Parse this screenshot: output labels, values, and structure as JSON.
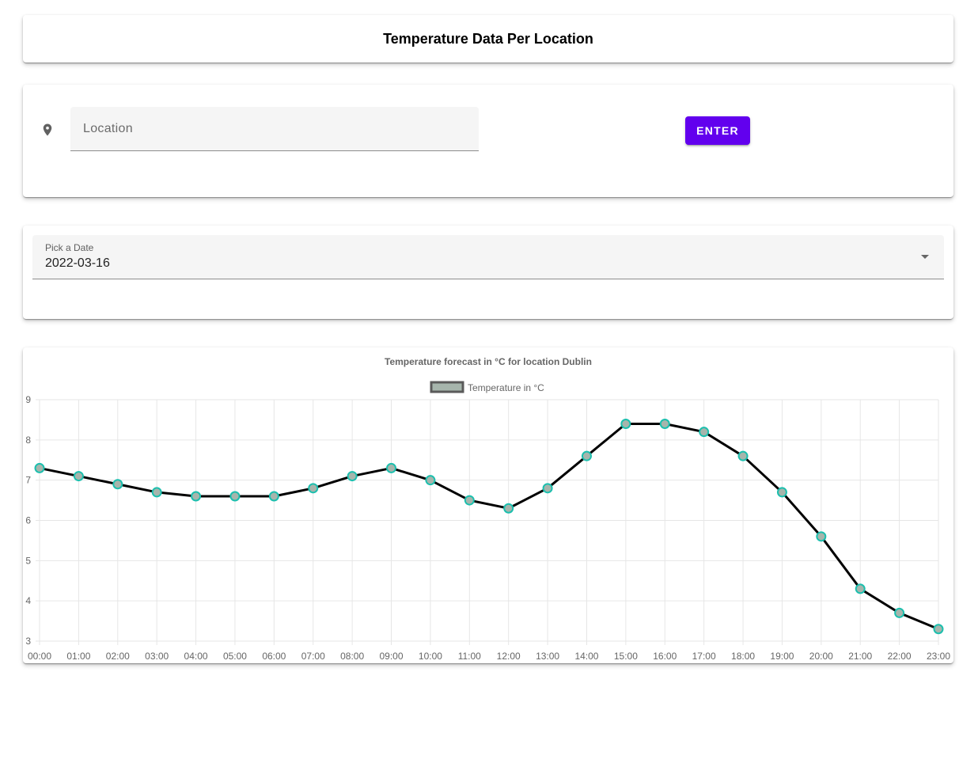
{
  "header": {
    "title": "Temperature Data Per Location"
  },
  "location_form": {
    "icon": "location-pin-icon",
    "input_placeholder": "Location",
    "input_value": "",
    "enter_label": "Enter"
  },
  "date_picker": {
    "label": "Pick a Date",
    "selected": "2022-03-16"
  },
  "chart_data": {
    "type": "line",
    "title": "Temperature forecast in °C for location Dublin",
    "categories": [
      "00:00",
      "01:00",
      "02:00",
      "03:00",
      "04:00",
      "05:00",
      "06:00",
      "07:00",
      "08:00",
      "09:00",
      "10:00",
      "11:00",
      "12:00",
      "13:00",
      "14:00",
      "15:00",
      "16:00",
      "17:00",
      "18:00",
      "19:00",
      "20:00",
      "21:00",
      "22:00",
      "23:00"
    ],
    "series": [
      {
        "name": "Temperature in °C",
        "values": [
          7.3,
          7.1,
          6.9,
          6.7,
          6.6,
          6.6,
          6.6,
          6.8,
          7.1,
          7.3,
          7.0,
          6.5,
          6.3,
          6.8,
          7.6,
          8.4,
          8.4,
          8.2,
          7.6,
          6.7,
          5.6,
          4.3,
          3.7,
          3.3
        ]
      }
    ],
    "ylim": [
      3,
      9
    ],
    "yticks": [
      "3",
      "4",
      "5",
      "6",
      "7",
      "8",
      "9"
    ],
    "grid": true,
    "legend": "top-center",
    "colors": {
      "line": "#000000",
      "point_fill": "#a6b5ac",
      "point_stroke": "#1cbfae",
      "grid": "#e6e6e6"
    }
  },
  "colors": {
    "accent": "#6200ee"
  }
}
